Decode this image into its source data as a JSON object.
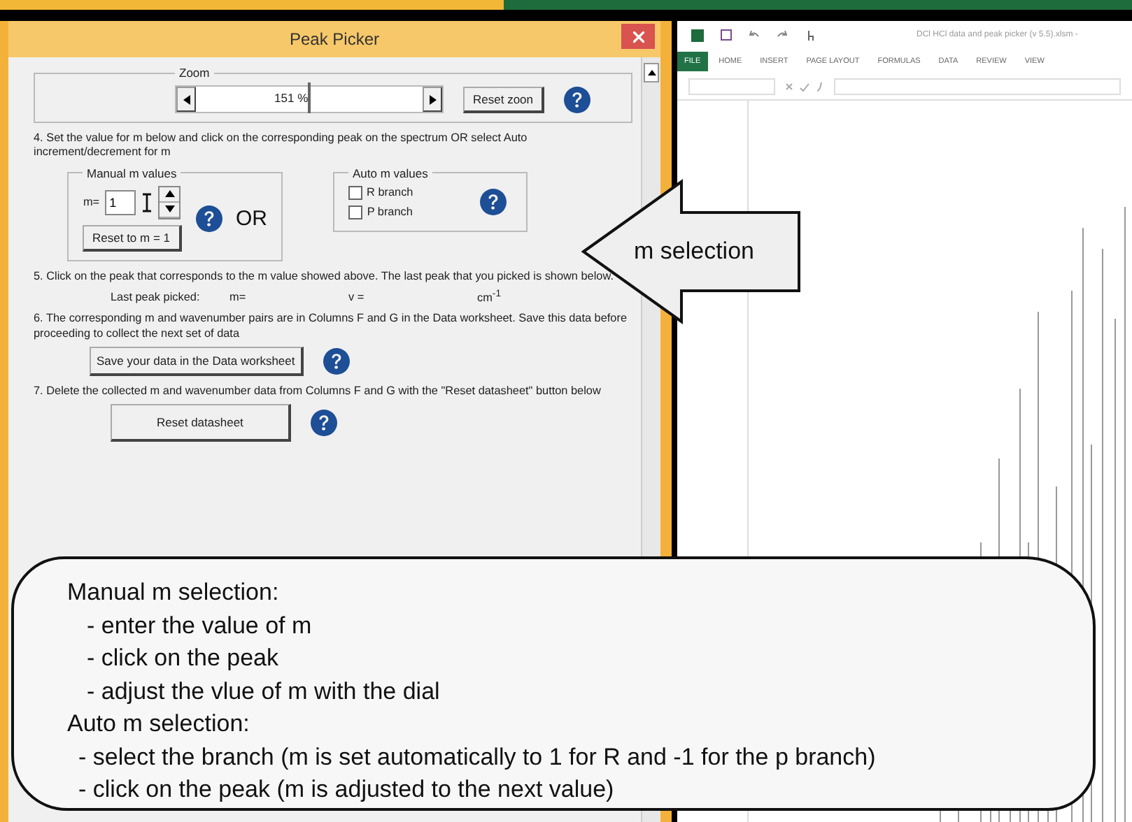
{
  "dialog": {
    "title": "Peak Picker",
    "zoom": {
      "legend": "Zoom",
      "value": "151",
      "unit": "%",
      "level": 0.5,
      "reset_button": "Reset zoon"
    },
    "step4": "4. Set the value for m  below and click on the corresponding peak on the spectrum OR select Auto increment/decrement for m",
    "manual": {
      "legend": "Manual m values",
      "label": "m=",
      "value": "1",
      "reset_button": "Reset to m = 1"
    },
    "or_label": "OR",
    "auto": {
      "legend": "Auto m values",
      "options": [
        {
          "label": "R branch",
          "checked": false
        },
        {
          "label": "P branch",
          "checked": false
        }
      ]
    },
    "step5": "5. Click on the peak that corresponds to the m value showed above. The last peak that you picked is shown below.",
    "last_peak": {
      "label": "Last peak picked:",
      "m_label": "m=",
      "nu_label": "v =",
      "unit": "cm$^{-1}$"
    },
    "step6": "6. The corresponding m and wavenumber pairs are in Columns F and G in the Data worksheet. Save this data before proceeding  to collect the next set of data",
    "save_button": "Save your data in the Data worksheet",
    "step7": "7. Delete the collected m and wavenumber data from Columns F and G with the \"Reset datasheet\" button below",
    "reset_datasheet_button": "Reset datasheet"
  },
  "excel": {
    "title": "DCl HCl data and peak picker (v 5.5).xlsm -",
    "tabs": [
      {
        "label": "FILE",
        "selected": true
      },
      {
        "label": "HOME",
        "selected": false
      },
      {
        "label": "INSERT",
        "selected": false
      },
      {
        "label": "PAGE LAYOUT",
        "selected": false
      },
      {
        "label": "FORMULAS",
        "selected": false
      },
      {
        "label": "DATA",
        "selected": false
      },
      {
        "label": "REVIEW",
        "selected": false
      },
      {
        "label": "VIEW",
        "selected": false
      }
    ]
  },
  "arrow_callout": {
    "text": "m selection"
  },
  "notes": {
    "lines": [
      {
        "text": "Manual m selection:",
        "kind": "heading"
      },
      {
        "text": "- enter the value of m",
        "kind": "item"
      },
      {
        "text": "- click on the peak",
        "kind": "item"
      },
      {
        "text": "- adjust the vlue of m with the dial",
        "kind": "item"
      },
      {
        "text": "Auto m selection:",
        "kind": "heading"
      },
      {
        "text": "- select the branch (m is set automatically to 1 for R and -1 for the p branch)",
        "kind": "subitem"
      },
      {
        "text": "- click on the peak (m is adjusted to the next value)",
        "kind": "subitem"
      }
    ]
  }
}
